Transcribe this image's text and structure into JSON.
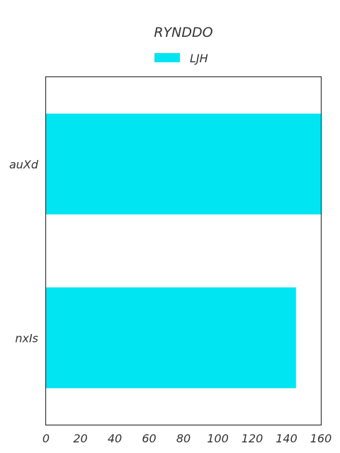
{
  "chart_data": {
    "type": "bar",
    "orientation": "horizontal",
    "title": "RYNDDO",
    "xlabel": "",
    "ylabel": "",
    "categories": [
      "auXd",
      "nxIs"
    ],
    "series": [
      {
        "name": "LJH",
        "values": [
          160,
          145.5
        ],
        "color": "#00e5f2"
      }
    ],
    "xlim": [
      0,
      160
    ],
    "xticks": [
      "0",
      "20",
      "40",
      "60",
      "80",
      "100",
      "120",
      "140",
      "160"
    ],
    "legend_position": "top-center",
    "grid": false
  }
}
